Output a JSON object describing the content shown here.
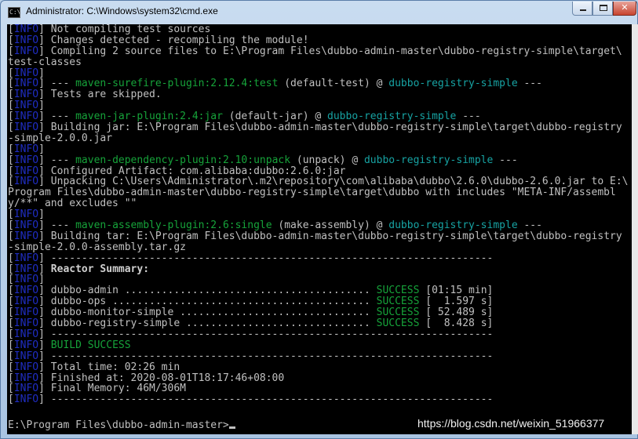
{
  "window": {
    "title": "Administrator: C:\\Windows\\system32\\cmd.exe",
    "icon_text": "C:\\",
    "controls": {
      "minimize": "minimize-icon",
      "maximize": "maximize-icon",
      "close": "✕"
    }
  },
  "console": {
    "level_label": "INFO",
    "lines": [
      {
        "info": true,
        "segs": [
          {
            "t": "Not compiling test sources",
            "c": "txt"
          }
        ]
      },
      {
        "info": true,
        "segs": [
          {
            "t": "Changes detected - recompiling the module!",
            "c": "txt"
          }
        ]
      },
      {
        "info": true,
        "segs": [
          {
            "t": "Compiling 2 source files to E:\\Program Files\\dubbo-admin-master\\dubbo-registry-simple\\target\\",
            "c": "txt"
          }
        ]
      },
      {
        "info": false,
        "segs": [
          {
            "t": "test-classes",
            "c": "txt"
          }
        ]
      },
      {
        "info": true,
        "segs": []
      },
      {
        "info": true,
        "segs": [
          {
            "t": "--- ",
            "c": "txt"
          },
          {
            "t": "maven-surefire-plugin:2.12.4:test",
            "c": "plugin"
          },
          {
            "t": " (default-test) @ ",
            "c": "txt"
          },
          {
            "t": "dubbo-registry-simple",
            "c": "module"
          },
          {
            "t": " ---",
            "c": "txt"
          }
        ]
      },
      {
        "info": true,
        "segs": [
          {
            "t": "Tests are skipped.",
            "c": "txt"
          }
        ]
      },
      {
        "info": true,
        "segs": []
      },
      {
        "info": true,
        "segs": [
          {
            "t": "--- ",
            "c": "txt"
          },
          {
            "t": "maven-jar-plugin:2.4:jar",
            "c": "plugin"
          },
          {
            "t": " (default-jar) @ ",
            "c": "txt"
          },
          {
            "t": "dubbo-registry-simple",
            "c": "module"
          },
          {
            "t": " ---",
            "c": "txt"
          }
        ]
      },
      {
        "info": true,
        "segs": [
          {
            "t": "Building jar: E:\\Program Files\\dubbo-admin-master\\dubbo-registry-simple\\target\\dubbo-registry",
            "c": "txt"
          }
        ]
      },
      {
        "info": false,
        "segs": [
          {
            "t": "-simple-2.0.0.jar",
            "c": "txt"
          }
        ]
      },
      {
        "info": true,
        "segs": []
      },
      {
        "info": true,
        "segs": [
          {
            "t": "--- ",
            "c": "txt"
          },
          {
            "t": "maven-dependency-plugin:2.10:unpack",
            "c": "plugin"
          },
          {
            "t": " (unpack) @ ",
            "c": "txt"
          },
          {
            "t": "dubbo-registry-simple",
            "c": "module"
          },
          {
            "t": " ---",
            "c": "txt"
          }
        ]
      },
      {
        "info": true,
        "segs": [
          {
            "t": "Configured Artifact: com.alibaba:dubbo:2.6.0:jar",
            "c": "txt"
          }
        ]
      },
      {
        "info": true,
        "segs": [
          {
            "t": "Unpacking C:\\Users\\Administrator\\.m2\\repository\\com\\alibaba\\dubbo\\2.6.0\\dubbo-2.6.0.jar to E:\\",
            "c": "txt"
          }
        ]
      },
      {
        "info": false,
        "segs": [
          {
            "t": "Program Files\\dubbo-admin-master\\dubbo-registry-simple\\target\\dubbo with includes \"META-INF/assembl",
            "c": "txt"
          }
        ]
      },
      {
        "info": false,
        "segs": [
          {
            "t": "y/**\" and excludes \"\"",
            "c": "txt"
          }
        ]
      },
      {
        "info": true,
        "segs": []
      },
      {
        "info": true,
        "segs": [
          {
            "t": "--- ",
            "c": "txt"
          },
          {
            "t": "maven-assembly-plugin:2.6:single",
            "c": "plugin"
          },
          {
            "t": " (make-assembly) @ ",
            "c": "txt"
          },
          {
            "t": "dubbo-registry-simple",
            "c": "module"
          },
          {
            "t": " ---",
            "c": "txt"
          }
        ]
      },
      {
        "info": true,
        "segs": [
          {
            "t": "Building tar: E:\\Program Files\\dubbo-admin-master\\dubbo-registry-simple\\target\\dubbo-registry",
            "c": "txt"
          }
        ]
      },
      {
        "info": false,
        "segs": [
          {
            "t": "-simple-2.0.0-assembly.tar.gz",
            "c": "txt"
          }
        ]
      },
      {
        "info": true,
        "segs": [
          {
            "t": "------------------------------------------------------------------------",
            "c": "txt"
          }
        ]
      },
      {
        "info": true,
        "segs": [
          {
            "t": "Reactor Summary:",
            "c": "bold"
          }
        ]
      },
      {
        "info": true,
        "segs": []
      },
      {
        "info": true,
        "segs": [
          {
            "t": "dubbo-admin ........................................ ",
            "c": "txt"
          },
          {
            "t": "SUCCESS",
            "c": "success"
          },
          {
            "t": " [01:15 min]",
            "c": "txt"
          }
        ]
      },
      {
        "info": true,
        "segs": [
          {
            "t": "dubbo-ops .......................................... ",
            "c": "txt"
          },
          {
            "t": "SUCCESS",
            "c": "success"
          },
          {
            "t": " [  1.597 s]",
            "c": "txt"
          }
        ]
      },
      {
        "info": true,
        "segs": [
          {
            "t": "dubbo-monitor-simple ............................... ",
            "c": "txt"
          },
          {
            "t": "SUCCESS",
            "c": "success"
          },
          {
            "t": " [ 52.489 s]",
            "c": "txt"
          }
        ]
      },
      {
        "info": true,
        "segs": [
          {
            "t": "dubbo-registry-simple .............................. ",
            "c": "txt"
          },
          {
            "t": "SUCCESS",
            "c": "success"
          },
          {
            "t": " [  8.428 s]",
            "c": "txt"
          }
        ]
      },
      {
        "info": true,
        "segs": [
          {
            "t": "------------------------------------------------------------------------",
            "c": "txt"
          }
        ]
      },
      {
        "info": true,
        "segs": [
          {
            "t": "BUILD SUCCESS",
            "c": "success"
          }
        ]
      },
      {
        "info": true,
        "segs": [
          {
            "t": "------------------------------------------------------------------------",
            "c": "txt"
          }
        ]
      },
      {
        "info": true,
        "segs": [
          {
            "t": "Total time: 02:26 min",
            "c": "txt"
          }
        ]
      },
      {
        "info": true,
        "segs": [
          {
            "t": "Finished at: 2020-08-01T18:17:46+08:00",
            "c": "txt"
          }
        ]
      },
      {
        "info": true,
        "segs": [
          {
            "t": "Final Memory: 46M/306M",
            "c": "txt"
          }
        ]
      },
      {
        "info": true,
        "segs": [
          {
            "t": "------------------------------------------------------------------------",
            "c": "txt"
          }
        ]
      }
    ],
    "prompt": "E:\\Program Files\\dubbo-admin-master>"
  },
  "watermark": "https://blog.csdn.net/weixin_51966377",
  "colors": {
    "background": "#000000",
    "text": "#c0c0c0",
    "info": "#1f2dc2",
    "plugin": "#16a33a",
    "module": "#17a3a3",
    "success": "#16a33a"
  }
}
